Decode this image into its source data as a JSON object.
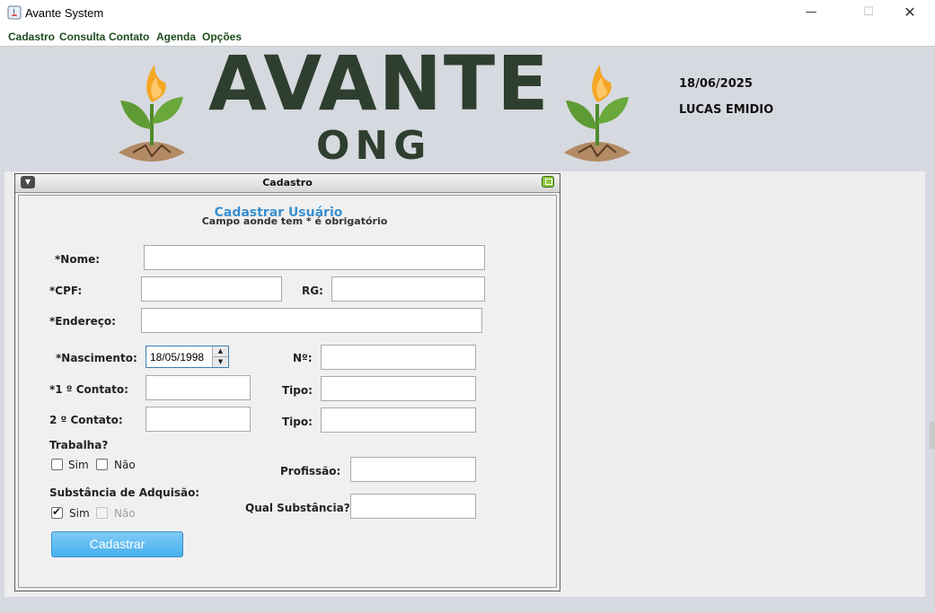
{
  "window": {
    "title": "Avante System",
    "minimize_glyph": "—",
    "maximize_glyph": "☐",
    "close_glyph": "✕"
  },
  "menu": {
    "items": [
      {
        "label": "Cadastro"
      },
      {
        "label": "Consulta"
      },
      {
        "label": "Contato"
      },
      {
        "label": "Agenda"
      },
      {
        "label": "Opções"
      }
    ]
  },
  "header": {
    "logo_text": "AVANTE",
    "logo_subtext": "ONG",
    "date": "18/06/2025",
    "user": "LUCAS EMIDIO"
  },
  "frame": {
    "title": "Cadastro",
    "menu_glyph": "▼"
  },
  "form": {
    "title": "Cadastrar Usuário",
    "subtitle": "Campo aonde tem * é obrigatório",
    "labels": {
      "nome": "*Nome:",
      "cpf": "*CPF:",
      "rg": "RG:",
      "endereco": "*Endereço:",
      "nascimento": "*Nascimento:",
      "numero": "Nº:",
      "contato1": "*1 º Contato:",
      "tipo1": "Tipo:",
      "contato2": "2 º Contato:",
      "tipo2": "Tipo:",
      "trabalha": "Trabalha?",
      "profissao": "Profissão:",
      "substancia": "Substância de Adquisão:",
      "qual_substancia": "Qual Substância?"
    },
    "values": {
      "nome": "",
      "cpf": "",
      "rg": "",
      "endereco": "",
      "nascimento": "18/05/1998",
      "numero": "",
      "contato1": "",
      "tipo1": "",
      "contato2": "",
      "tipo2": "",
      "profissao": "",
      "qual_substancia": ""
    },
    "checkboxes": {
      "trabalha_sim": {
        "label": "Sim",
        "checked": false
      },
      "trabalha_nao": {
        "label": "Não",
        "checked": false
      },
      "substancia_sim": {
        "label": "Sim",
        "checked": true
      },
      "substancia_nao": {
        "label": "Não",
        "checked": false,
        "disabled": true
      }
    },
    "submit_label": "Cadastrar"
  },
  "colors": {
    "accent": "#3a8fd0",
    "button": "#47b0ee",
    "menu_text": "#1e4d1e",
    "logo_text": "#2f3f2f"
  }
}
